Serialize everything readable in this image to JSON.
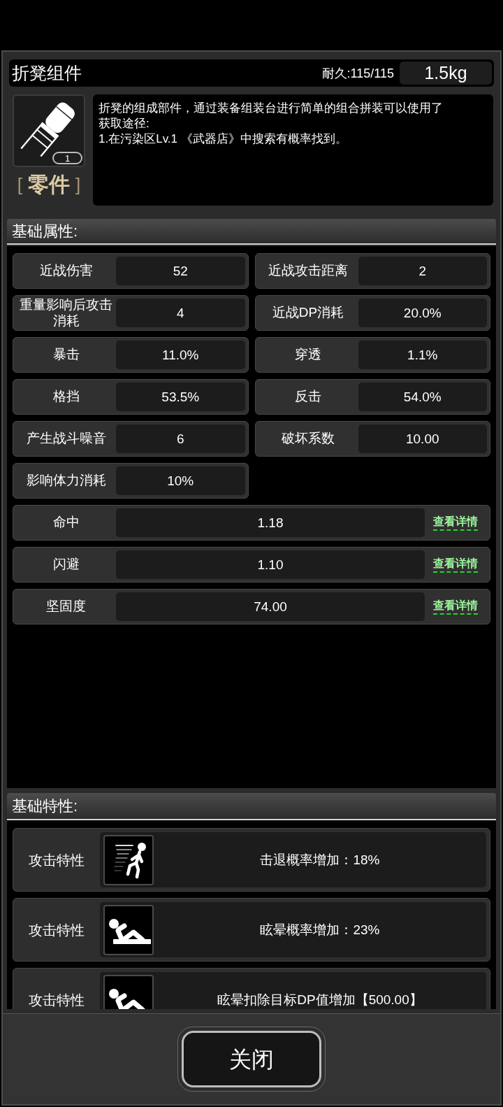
{
  "item": {
    "name": "折凳组件",
    "durability": "耐久:115/115",
    "weight": "1.5kg",
    "count": "1",
    "category": {
      "bracket_open": "[",
      "label": "零件",
      "bracket_close": "]"
    },
    "description": "折凳的组成部件，通过装备组装台进行简单的组合拼装可以使用了",
    "source_heading": "获取途径:",
    "sources": [
      "1.在污染区Lv.1 《武器店》中搜索有概率找到。"
    ]
  },
  "basic_attributes": {
    "title": "基础属性:",
    "stats": [
      {
        "label": "近战伤害",
        "value": "52"
      },
      {
        "label": "近战攻击距离",
        "value": "2"
      },
      {
        "label": "重量影响后攻击消耗",
        "value": "4"
      },
      {
        "label": "近战DP消耗",
        "value": "20.0%"
      },
      {
        "label": "暴击",
        "value": "11.0%"
      },
      {
        "label": "穿透",
        "value": "1.1%"
      },
      {
        "label": "格挡",
        "value": "53.5%"
      },
      {
        "label": "反击",
        "value": "54.0%"
      },
      {
        "label": "产生战斗噪音",
        "value": "6"
      },
      {
        "label": "破坏系数",
        "value": "10.00"
      },
      {
        "label": "影响体力消耗",
        "value": "10%"
      }
    ],
    "detail_stats": [
      {
        "label": "命中",
        "value": "1.18",
        "link": "查看详情"
      },
      {
        "label": "闪避",
        "value": "1.10",
        "link": "查看详情"
      },
      {
        "label": "坚固度",
        "value": "74.00",
        "link": "查看详情"
      }
    ]
  },
  "basic_traits": {
    "title": "基础特性:",
    "traits": [
      {
        "label": "攻击特性",
        "kind": "knockback",
        "text": "击退概率增加：18%"
      },
      {
        "label": "攻击特性",
        "kind": "stun",
        "text": "眩晕概率增加：23%"
      },
      {
        "label": "攻击特性",
        "kind": "stun",
        "text": "眩晕扣除目标DP值增加【500.00】"
      }
    ]
  },
  "close_button": {
    "label": "关闭"
  }
}
